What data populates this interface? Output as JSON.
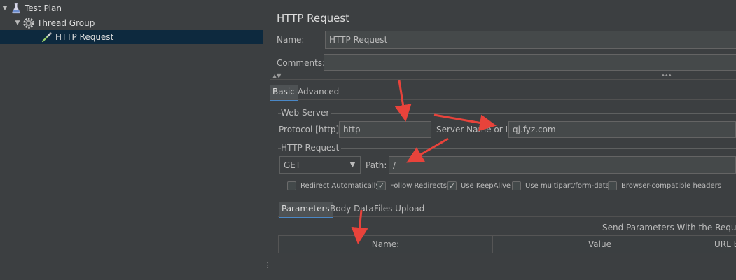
{
  "tree": {
    "items": [
      {
        "label": "Test Plan",
        "icon": "flask-icon"
      },
      {
        "label": "Thread Group",
        "icon": "gear-icon"
      },
      {
        "label": "HTTP Request",
        "icon": "pipette-icon",
        "selected": true
      }
    ]
  },
  "editor": {
    "title": "HTTP Request",
    "name_label": "Name:",
    "name_value": "HTTP Request",
    "comments_label": "Comments:",
    "comments_value": "",
    "tabs": [
      {
        "label": "Basic",
        "active": true
      },
      {
        "label": "Advanced",
        "active": false
      }
    ],
    "web_server": {
      "group_label": "Web Server",
      "protocol_label": "Protocol [http]:",
      "protocol_value": "http",
      "server_label": "Server Name or IP:",
      "server_value": "qj.fyz.com"
    },
    "http_request": {
      "group_label": "HTTP Request",
      "method": "GET",
      "path_label": "Path:",
      "path_value": "/"
    },
    "options": [
      {
        "label": "Redirect Automatically",
        "checked": false
      },
      {
        "label": "Follow Redirects",
        "checked": true
      },
      {
        "label": "Use KeepAlive",
        "checked": true
      },
      {
        "label": "Use multipart/form-data",
        "checked": false
      },
      {
        "label": "Browser-compatible headers",
        "checked": false
      }
    ],
    "subtabs": [
      {
        "label": "Parameters",
        "active": true
      },
      {
        "label": "Body Data",
        "active": false
      },
      {
        "label": "Files Upload",
        "active": false
      }
    ],
    "send_params_label": "Send Parameters With the Request:",
    "columns": [
      "Name:",
      "Value",
      "URL E"
    ]
  },
  "colors": {
    "background": "#3c3f41",
    "selected_row": "#0d293e",
    "accent": "#4a88c7",
    "annotation_arrow": "#e8433b"
  }
}
